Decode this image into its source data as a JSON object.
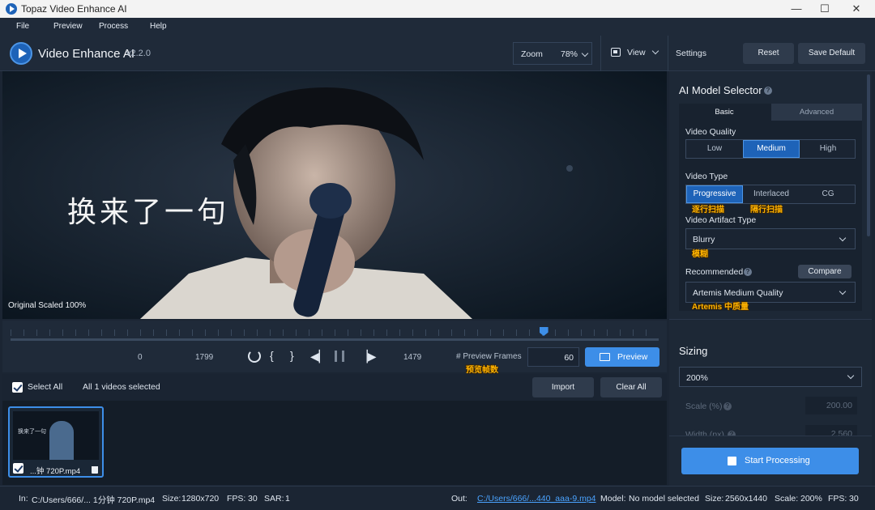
{
  "window": {
    "title": "Topaz Video Enhance AI",
    "minimize": "—",
    "maximize": "☐",
    "close": "✕"
  },
  "menu": [
    "File",
    "Preview",
    "Process",
    "Help"
  ],
  "header": {
    "app_name": "Video Enhance AI",
    "version": "v2.2.0",
    "zoom_label": "Zoom",
    "zoom_value": "78%",
    "view_label": "View",
    "settings_label": "Settings",
    "reset_label": "Reset",
    "save_default_label": "Save Default"
  },
  "preview": {
    "handwritten_text": "换来了一句",
    "scale_label": "Original Scaled 100%"
  },
  "timeline": {
    "start_frame": "0",
    "end_frame": "1799",
    "current_frame": "1479",
    "preview_frames_label": "# Preview Frames",
    "preview_frames_value": "60",
    "preview_button": "Preview",
    "annotation_preview_frames": "预览帧数",
    "playhead_fraction": 0.822
  },
  "list": {
    "select_all": "Select All",
    "selected_text": "All 1 videos selected",
    "import_label": "Import",
    "clear_all_label": "Clear All"
  },
  "file": {
    "thumb_caption": "...钟 720P.mp4",
    "thumb_text": "换来了一句"
  },
  "panel": {
    "ai_model_title": "AI Model Selector",
    "tabs": [
      "Basic",
      "Advanced"
    ],
    "video_quality_label": "Video Quality",
    "quality_options": [
      "Low",
      "Medium",
      "High"
    ],
    "video_type_label": "Video Type",
    "type_options": [
      "Progressive",
      "Interlaced",
      "CG"
    ],
    "annotation_progressive": "逐行扫描",
    "annotation_interlaced": "隔行扫描",
    "artifact_label": "Video Artifact Type",
    "artifact_value": "Blurry",
    "annotation_blurry": "模糊",
    "recommended_label": "Recommended",
    "compare_label": "Compare",
    "recommended_value": "Artemis Medium Quality",
    "annotation_artemis": "Artemis 中质量",
    "sizing_title": "Sizing",
    "sizing_value": "200%",
    "scale_label": "Scale (%)",
    "scale_value": "200.00",
    "width_label": "Width (px)",
    "width_value": "2,560",
    "start_processing": "Start Processing"
  },
  "status": {
    "in_label": "In:",
    "in_path": "C:/Users/666/... 1分钟 720P.mp4",
    "in_size_label": "Size:",
    "in_size": "1280x720",
    "in_fps_label": "FPS:",
    "in_fps": "30",
    "sar_label": "SAR:",
    "sar": "1",
    "out_label": "Out:",
    "out_path": "C:/Users/666/...440_aaa-9.mp4",
    "model_label": "Model:",
    "model_value": "No model selected",
    "out_size_label": "Size:",
    "out_size": "2560x1440",
    "out_scale_label": "Scale:",
    "out_scale": "200%",
    "out_fps_label": "FPS:",
    "out_fps": "30"
  },
  "colors": {
    "accent": "#1e63b8",
    "accent_light": "#3d8ee8",
    "annotation": "#ffb300"
  }
}
